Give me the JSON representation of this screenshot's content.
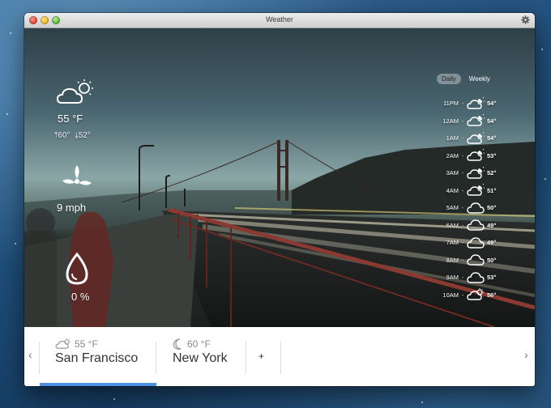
{
  "window": {
    "title": "Weather"
  },
  "current": {
    "temperature": "55 °F",
    "high": "60°",
    "low": "52°",
    "wind": "9 mph",
    "precipitation": "0 %"
  },
  "forecast": {
    "modes": [
      "Daily",
      "Weekly"
    ],
    "active_mode": "Daily",
    "rows": [
      {
        "time": "11PM",
        "icon": "cloud-moon-icon",
        "temp": "54°"
      },
      {
        "time": "12AM",
        "icon": "cloud-moon-icon",
        "temp": "54°"
      },
      {
        "time": "1AM",
        "icon": "cloud-moon-icon",
        "temp": "54°"
      },
      {
        "time": "2AM",
        "icon": "cloud-moon-icon",
        "temp": "53°"
      },
      {
        "time": "3AM",
        "icon": "cloud-moon-icon",
        "temp": "52°"
      },
      {
        "time": "4AM",
        "icon": "cloud-moon-icon",
        "temp": "51°"
      },
      {
        "time": "5AM",
        "icon": "cloud-icon",
        "temp": "50°"
      },
      {
        "time": "6AM",
        "icon": "cloud-icon",
        "temp": "49°"
      },
      {
        "time": "7AM",
        "icon": "cloud-icon",
        "temp": "49°"
      },
      {
        "time": "8AM",
        "icon": "cloud-icon",
        "temp": "50°"
      },
      {
        "time": "9AM",
        "icon": "cloud-icon",
        "temp": "53°"
      },
      {
        "time": "10AM",
        "icon": "cloud-sun-icon",
        "temp": "56°"
      }
    ]
  },
  "cities": [
    {
      "name": "San Francisco",
      "temp": "55 °F",
      "icon": "cloud-sun-icon",
      "selected": true
    },
    {
      "name": "New York",
      "temp": "60 °F",
      "icon": "moon-icon",
      "selected": false
    }
  ],
  "add_city_label": "+",
  "nav": {
    "prev": "‹",
    "next": "›"
  },
  "colors": {
    "accent": "#4a90e2"
  }
}
